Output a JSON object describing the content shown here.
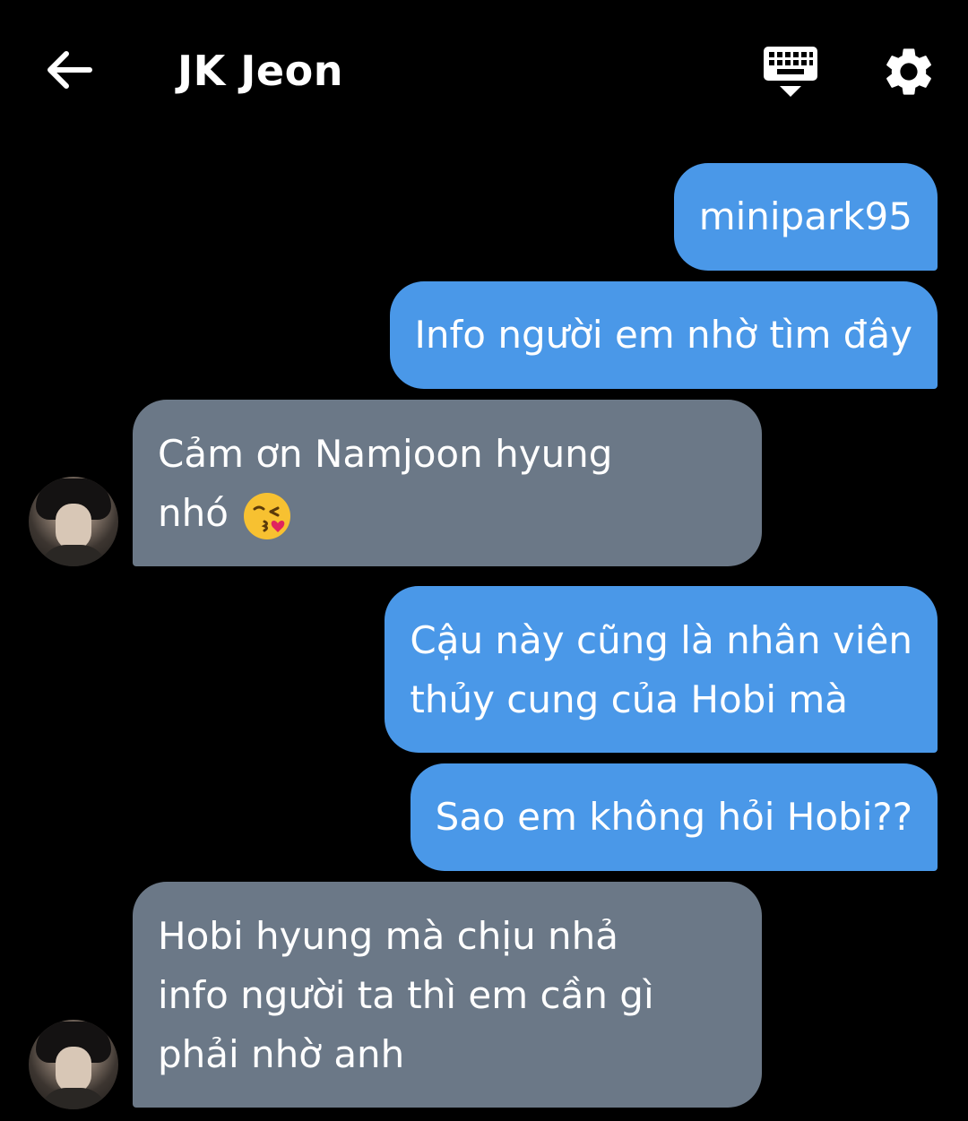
{
  "header": {
    "title": "JK Jeon",
    "back_icon": "arrow-left-icon",
    "keyboard_icon": "keyboard-hide-icon",
    "settings_icon": "gear-icon"
  },
  "colors": {
    "background": "#000000",
    "outgoing_bubble": "#4a98e8",
    "incoming_bubble": "#6b7887",
    "text": "#ffffff"
  },
  "messages": [
    {
      "direction": "out",
      "lines": [
        "minipark95"
      ]
    },
    {
      "direction": "out",
      "lines": [
        "Info người em nhờ tìm đây"
      ]
    },
    {
      "direction": "in",
      "lines": [
        "Cảm ơn Namjoon hyung",
        "nhó"
      ],
      "emoji": "face-blowing-kiss"
    },
    {
      "direction": "out",
      "lines": [
        "Cậu này cũng là nhân viên",
        "thủy cung của Hobi mà"
      ]
    },
    {
      "direction": "out",
      "lines": [
        "Sao em không hỏi Hobi??"
      ]
    },
    {
      "direction": "in",
      "lines": [
        "Hobi hyung mà chịu nhả",
        "info người ta thì em cần gì",
        "phải nhờ anh"
      ]
    }
  ]
}
